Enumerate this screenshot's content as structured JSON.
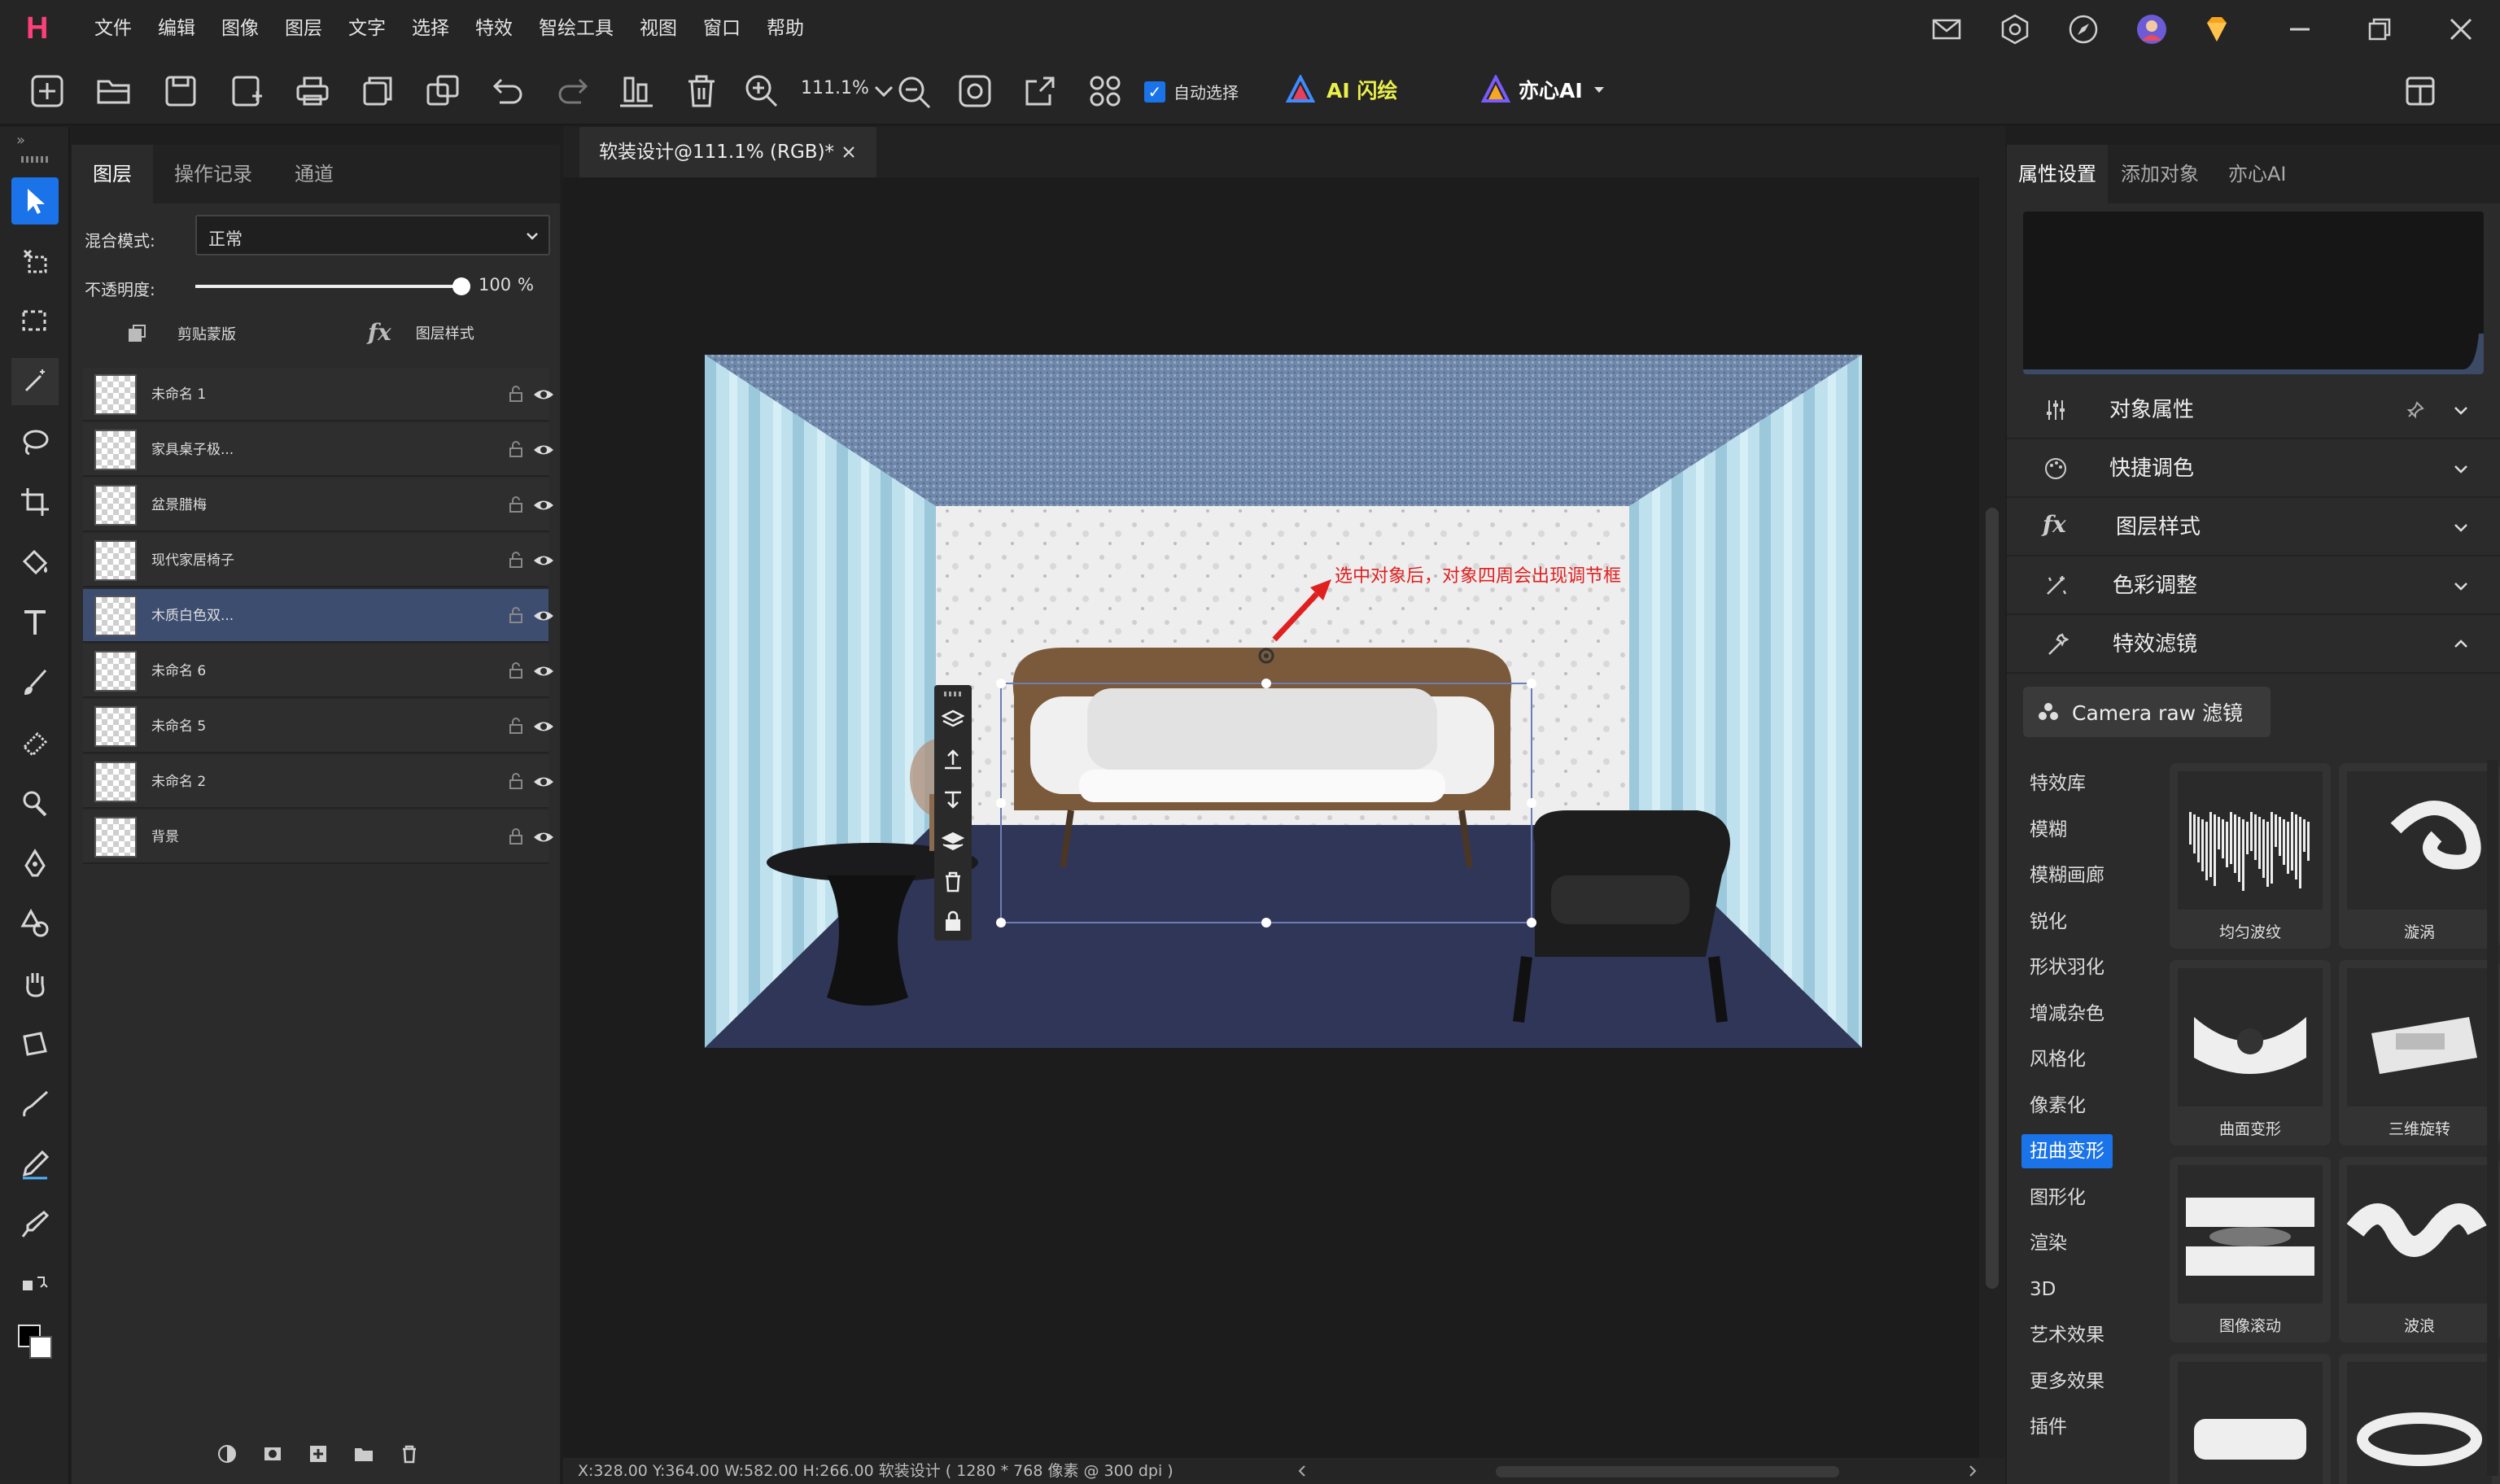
{
  "app": {
    "logo": "H"
  },
  "menu": [
    "文件",
    "编辑",
    "图像",
    "图层",
    "文字",
    "选择",
    "特效",
    "智绘工具",
    "视图",
    "窗口",
    "帮助"
  ],
  "toolbar": {
    "zoom": "111.1%",
    "auto_select": "自动选择",
    "auto_select_checked": true,
    "ai_flash": "AI 闪绘",
    "yixin_ai": "亦心AI"
  },
  "layers_panel": {
    "tabs": [
      "图层",
      "操作记录",
      "通道"
    ],
    "blend_label": "混合模式:",
    "blend_value": "正常",
    "opacity_label": "不透明度:",
    "opacity_value": "100",
    "opacity_unit": "%",
    "opacity_level": 1.0,
    "clip_mask": "剪贴蒙版",
    "layer_style": "图层样式",
    "layers": [
      {
        "name": "未命名 1",
        "locked": false,
        "visible": true,
        "selected": false
      },
      {
        "name": "家具桌子极...",
        "locked": false,
        "visible": true,
        "selected": false
      },
      {
        "name": "盆景腊梅",
        "locked": false,
        "visible": true,
        "selected": false
      },
      {
        "name": "现代家居椅子",
        "locked": false,
        "visible": true,
        "selected": false
      },
      {
        "name": "木质白色双...",
        "locked": false,
        "visible": true,
        "selected": true
      },
      {
        "name": "未命名 6",
        "locked": false,
        "visible": true,
        "selected": false
      },
      {
        "name": "未命名 5",
        "locked": false,
        "visible": true,
        "selected": false
      },
      {
        "name": "未命名 2",
        "locked": false,
        "visible": true,
        "selected": false
      },
      {
        "name": "背景",
        "locked": true,
        "visible": true,
        "selected": false
      }
    ]
  },
  "document": {
    "tab_title": "软装设计@111.1% (RGB)*",
    "annotation": "选中对象后，对象四周会出现调节框"
  },
  "status_bar": {
    "text": "X:328.00 Y:364.00 W:582.00 H:266.00   软装设计 ( 1280 * 768 像素 @ 300 dpi )"
  },
  "right_panel": {
    "tabs": [
      "属性设置",
      "添加对象",
      "亦心AI"
    ],
    "sections": [
      "对象属性",
      "快捷调色",
      "图层样式",
      "色彩调整",
      "特效滤镜"
    ],
    "camera_raw": "Camera raw 滤镜",
    "categories": [
      "特效库",
      "模糊",
      "模糊画廊",
      "锐化",
      "形状羽化",
      "增减杂色",
      "风格化",
      "像素化",
      "扭曲变形",
      "图形化",
      "渲染",
      "3D",
      "艺术效果",
      "更多效果",
      "插件"
    ],
    "selected_category": "扭曲变形",
    "effects": [
      "均匀波纹",
      "漩涡",
      "曲面变形",
      "三维旋转",
      "图像滚动",
      "波浪",
      "",
      ""
    ]
  },
  "colors": {
    "accent": "#1a73e8",
    "selected_layer": "#3d4d70",
    "annotation": "#e01f1f",
    "logo": "#ff3f7a"
  }
}
